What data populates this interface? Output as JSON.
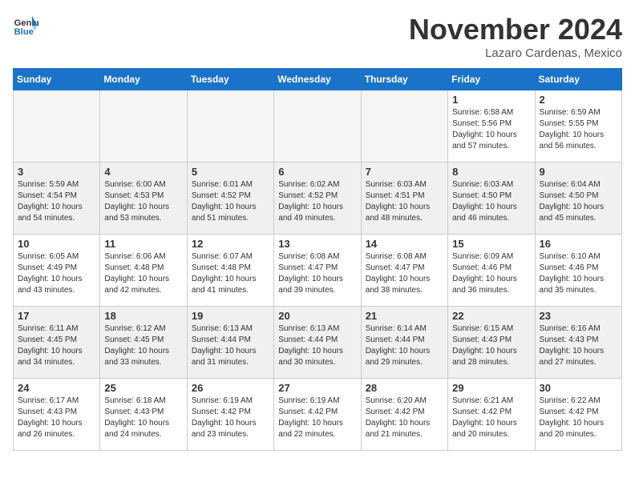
{
  "logo": {
    "line1": "General",
    "line2": "Blue"
  },
  "title": "November 2024",
  "subtitle": "Lazaro Cardenas, Mexico",
  "days_of_week": [
    "Sunday",
    "Monday",
    "Tuesday",
    "Wednesday",
    "Thursday",
    "Friday",
    "Saturday"
  ],
  "weeks": [
    [
      {
        "day": "",
        "info": "",
        "empty": true
      },
      {
        "day": "",
        "info": "",
        "empty": true
      },
      {
        "day": "",
        "info": "",
        "empty": true
      },
      {
        "day": "",
        "info": "",
        "empty": true
      },
      {
        "day": "",
        "info": "",
        "empty": true
      },
      {
        "day": "1",
        "info": "Sunrise: 6:58 AM\nSunset: 5:56 PM\nDaylight: 10 hours\nand 57 minutes."
      },
      {
        "day": "2",
        "info": "Sunrise: 6:59 AM\nSunset: 5:55 PM\nDaylight: 10 hours\nand 56 minutes."
      }
    ],
    [
      {
        "day": "3",
        "info": "Sunrise: 5:59 AM\nSunset: 4:54 PM\nDaylight: 10 hours\nand 54 minutes.",
        "shaded": true
      },
      {
        "day": "4",
        "info": "Sunrise: 6:00 AM\nSunset: 4:53 PM\nDaylight: 10 hours\nand 53 minutes.",
        "shaded": true
      },
      {
        "day": "5",
        "info": "Sunrise: 6:01 AM\nSunset: 4:52 PM\nDaylight: 10 hours\nand 51 minutes.",
        "shaded": true
      },
      {
        "day": "6",
        "info": "Sunrise: 6:02 AM\nSunset: 4:52 PM\nDaylight: 10 hours\nand 49 minutes.",
        "shaded": true
      },
      {
        "day": "7",
        "info": "Sunrise: 6:03 AM\nSunset: 4:51 PM\nDaylight: 10 hours\nand 48 minutes.",
        "shaded": true
      },
      {
        "day": "8",
        "info": "Sunrise: 6:03 AM\nSunset: 4:50 PM\nDaylight: 10 hours\nand 46 minutes.",
        "shaded": true
      },
      {
        "day": "9",
        "info": "Sunrise: 6:04 AM\nSunset: 4:50 PM\nDaylight: 10 hours\nand 45 minutes.",
        "shaded": true
      }
    ],
    [
      {
        "day": "10",
        "info": "Sunrise: 6:05 AM\nSunset: 4:49 PM\nDaylight: 10 hours\nand 43 minutes."
      },
      {
        "day": "11",
        "info": "Sunrise: 6:06 AM\nSunset: 4:48 PM\nDaylight: 10 hours\nand 42 minutes."
      },
      {
        "day": "12",
        "info": "Sunrise: 6:07 AM\nSunset: 4:48 PM\nDaylight: 10 hours\nand 41 minutes."
      },
      {
        "day": "13",
        "info": "Sunrise: 6:08 AM\nSunset: 4:47 PM\nDaylight: 10 hours\nand 39 minutes."
      },
      {
        "day": "14",
        "info": "Sunrise: 6:08 AM\nSunset: 4:47 PM\nDaylight: 10 hours\nand 38 minutes."
      },
      {
        "day": "15",
        "info": "Sunrise: 6:09 AM\nSunset: 4:46 PM\nDaylight: 10 hours\nand 36 minutes."
      },
      {
        "day": "16",
        "info": "Sunrise: 6:10 AM\nSunset: 4:46 PM\nDaylight: 10 hours\nand 35 minutes."
      }
    ],
    [
      {
        "day": "17",
        "info": "Sunrise: 6:11 AM\nSunset: 4:45 PM\nDaylight: 10 hours\nand 34 minutes.",
        "shaded": true
      },
      {
        "day": "18",
        "info": "Sunrise: 6:12 AM\nSunset: 4:45 PM\nDaylight: 10 hours\nand 33 minutes.",
        "shaded": true
      },
      {
        "day": "19",
        "info": "Sunrise: 6:13 AM\nSunset: 4:44 PM\nDaylight: 10 hours\nand 31 minutes.",
        "shaded": true
      },
      {
        "day": "20",
        "info": "Sunrise: 6:13 AM\nSunset: 4:44 PM\nDaylight: 10 hours\nand 30 minutes.",
        "shaded": true
      },
      {
        "day": "21",
        "info": "Sunrise: 6:14 AM\nSunset: 4:44 PM\nDaylight: 10 hours\nand 29 minutes.",
        "shaded": true
      },
      {
        "day": "22",
        "info": "Sunrise: 6:15 AM\nSunset: 4:43 PM\nDaylight: 10 hours\nand 28 minutes.",
        "shaded": true
      },
      {
        "day": "23",
        "info": "Sunrise: 6:16 AM\nSunset: 4:43 PM\nDaylight: 10 hours\nand 27 minutes.",
        "shaded": true
      }
    ],
    [
      {
        "day": "24",
        "info": "Sunrise: 6:17 AM\nSunset: 4:43 PM\nDaylight: 10 hours\nand 26 minutes."
      },
      {
        "day": "25",
        "info": "Sunrise: 6:18 AM\nSunset: 4:43 PM\nDaylight: 10 hours\nand 24 minutes."
      },
      {
        "day": "26",
        "info": "Sunrise: 6:19 AM\nSunset: 4:42 PM\nDaylight: 10 hours\nand 23 minutes."
      },
      {
        "day": "27",
        "info": "Sunrise: 6:19 AM\nSunset: 4:42 PM\nDaylight: 10 hours\nand 22 minutes."
      },
      {
        "day": "28",
        "info": "Sunrise: 6:20 AM\nSunset: 4:42 PM\nDaylight: 10 hours\nand 21 minutes."
      },
      {
        "day": "29",
        "info": "Sunrise: 6:21 AM\nSunset: 4:42 PM\nDaylight: 10 hours\nand 20 minutes."
      },
      {
        "day": "30",
        "info": "Sunrise: 6:22 AM\nSunset: 4:42 PM\nDaylight: 10 hours\nand 20 minutes."
      }
    ]
  ]
}
